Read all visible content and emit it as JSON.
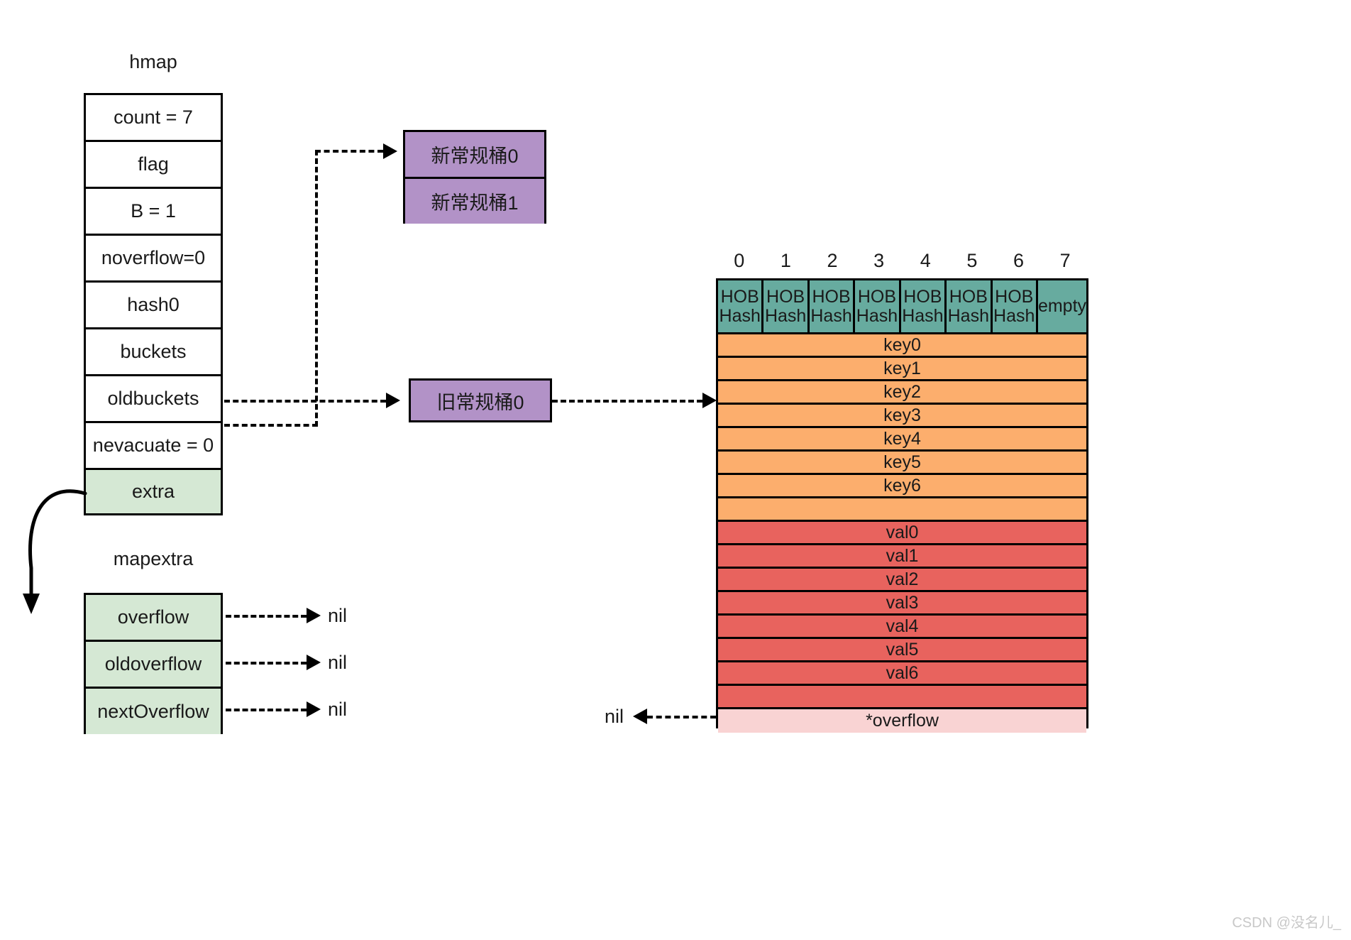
{
  "diagram": {
    "title_hmap": "hmap",
    "title_mapextra": "mapextra",
    "watermark": "CSDN @没名儿_"
  },
  "hmap": {
    "label": "hmap",
    "fields": [
      {
        "label": "count = 7",
        "highlight": false
      },
      {
        "label": "flag",
        "highlight": false
      },
      {
        "label": "B = 1",
        "highlight": false
      },
      {
        "label": "noverflow=0",
        "highlight": false
      },
      {
        "label": "hash0",
        "highlight": false
      },
      {
        "label": "buckets",
        "highlight": false
      },
      {
        "label": "oldbuckets",
        "highlight": false
      },
      {
        "label": "nevacuate = 0",
        "highlight": false
      },
      {
        "label": "extra",
        "highlight": true
      }
    ]
  },
  "mapextra": {
    "label": "mapextra",
    "fields": [
      {
        "label": "overflow",
        "target": "nil"
      },
      {
        "label": "oldoverflow",
        "target": "nil"
      },
      {
        "label": "nextOverflow",
        "target": "nil"
      }
    ]
  },
  "new_buckets": {
    "rows": [
      "新常规桶0",
      "新常规桶1"
    ]
  },
  "old_buckets": {
    "rows": [
      "旧常规桶0"
    ]
  },
  "bucket_table": {
    "column_indexes": [
      "0",
      "1",
      "2",
      "3",
      "4",
      "5",
      "6",
      "7"
    ],
    "tophash_cells": [
      {
        "line1": "HOB",
        "line2": "Hash"
      },
      {
        "line1": "HOB",
        "line2": "Hash"
      },
      {
        "line1": "HOB",
        "line2": "Hash"
      },
      {
        "line1": "HOB",
        "line2": "Hash"
      },
      {
        "line1": "HOB",
        "line2": "Hash"
      },
      {
        "line1": "HOB",
        "line2": "Hash"
      },
      {
        "line1": "HOB",
        "line2": "Hash"
      },
      {
        "line1": "empty",
        "line2": ""
      }
    ],
    "keys": [
      "key0",
      "key1",
      "key2",
      "key3",
      "key4",
      "key5",
      "key6",
      ""
    ],
    "values": [
      "val0",
      "val1",
      "val2",
      "val3",
      "val4",
      "val5",
      "val6",
      ""
    ],
    "overflow_row": "*overflow",
    "overflow_target": "nil"
  },
  "colors": {
    "tophash": "#67ab9f",
    "key": "#fcae6d",
    "value": "#e8635e",
    "overflow": "#f9d3d3",
    "bucket_purple": "#b292c7",
    "extra_green": "#d5e8d4",
    "stroke": "#000000"
  }
}
